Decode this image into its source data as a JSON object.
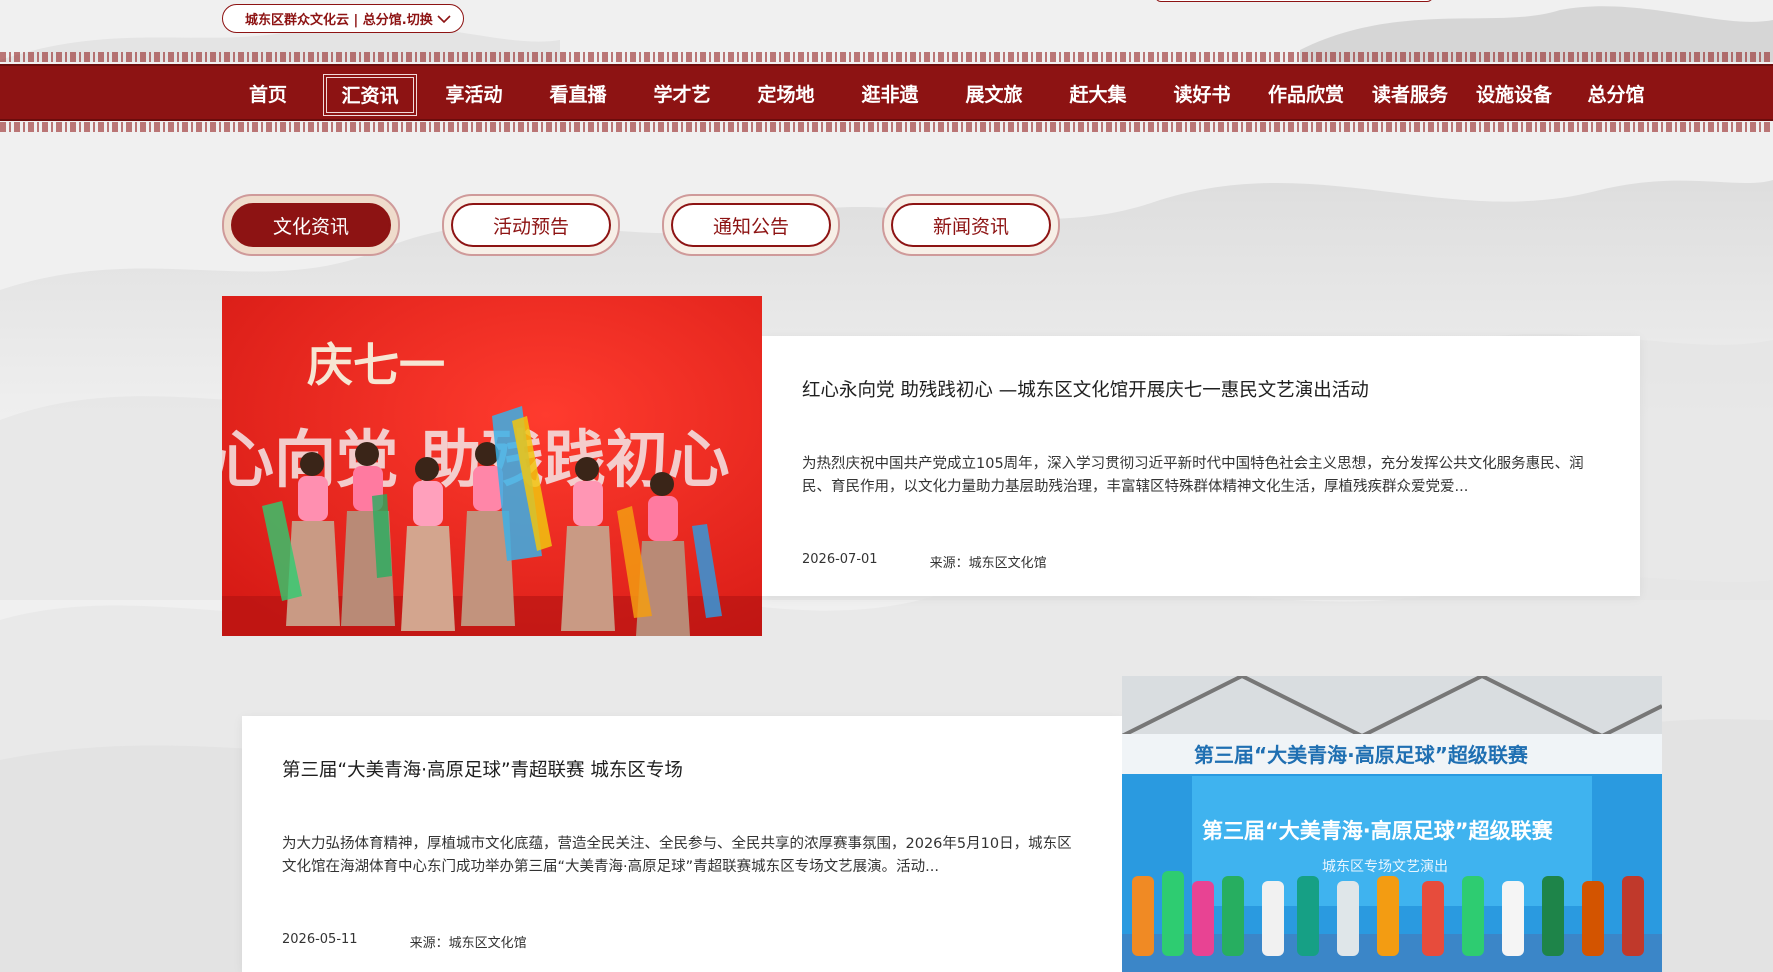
{
  "header": {
    "site_switch_label": "城东区群众文化云 | 总分馆.切换"
  },
  "nav": {
    "items": [
      {
        "label": "首页"
      },
      {
        "label": "汇资讯",
        "active": true
      },
      {
        "label": "享活动"
      },
      {
        "label": "看直播"
      },
      {
        "label": "学才艺"
      },
      {
        "label": "定场地"
      },
      {
        "label": "逛非遗"
      },
      {
        "label": "展文旅"
      },
      {
        "label": "赶大集"
      },
      {
        "label": "读好书"
      },
      {
        "label": "作品欣赏"
      },
      {
        "label": "读者服务"
      },
      {
        "label": "设施设备"
      },
      {
        "label": "总分馆"
      }
    ]
  },
  "tabs": [
    {
      "label": "文化资讯",
      "active": true
    },
    {
      "label": "活动预告"
    },
    {
      "label": "通知公告"
    },
    {
      "label": "新闻资讯"
    }
  ],
  "news": [
    {
      "title": "红心永向党 助残践初心 —城东区文化馆开展庆七一惠民文艺演出活动",
      "summary": "为热烈庆祝中国共产党成立105周年，深入学习贯彻习近平新时代中国特色社会主义思想，充分发挥公共文化服务惠民、润民、育民作用，以文化力量助力基层助残治理，丰富辖区特殊群体精神文化生活，厚植残疾群众爱党爱...",
      "date": "2026-07-01",
      "source": "来源：城东区文化馆",
      "image": {
        "banner_text_1": "庆七一",
        "banner_text_2": "心向党 助残践初心"
      }
    },
    {
      "title": "第三届“大美青海·高原足球”青超联赛 城东区专场",
      "summary": "为大力弘扬体育精神，厚植城市文化底蕴，营造全民关注、全民参与、全民共享的浓厚赛事氛围，2026年5月10日，城东区文化馆在海湖体育中心东门成功举办第三届“大美青海·高原足球”青超联赛城东区专场文艺展演。活动...",
      "date": "2026-05-11",
      "source": "来源：城东区文化馆",
      "image": {
        "banner_text_1": "第三届“大美青海·高原足球”超级联赛",
        "banner_text_2": "第三届“大美青海·高原足球”超级联赛",
        "banner_text_3": "城东区专场文艺演出"
      }
    }
  ],
  "colors": {
    "brand_red": "#8d1313",
    "background": "#efefef"
  }
}
